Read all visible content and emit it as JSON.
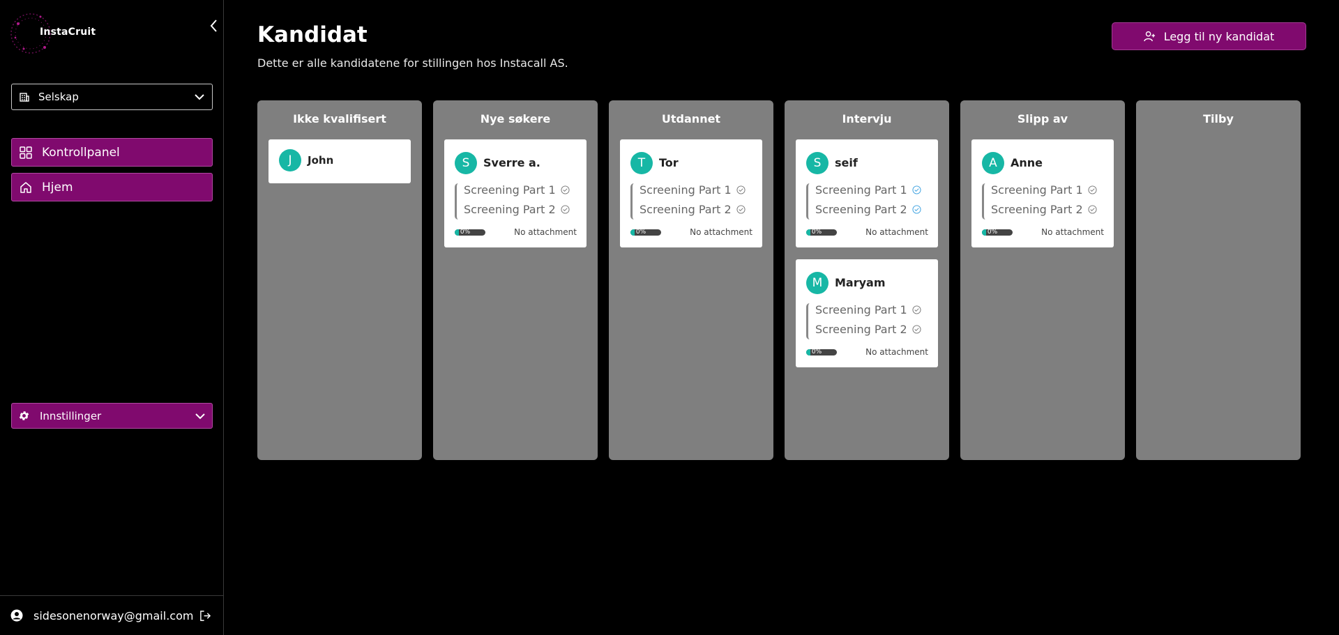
{
  "sidebar": {
    "logo_text": "InstaCruit",
    "company_select": "Selskap",
    "nav": [
      {
        "label": "Kontrollpanel",
        "icon": "grid-icon"
      },
      {
        "label": "Hjem",
        "icon": "home-icon"
      }
    ],
    "settings_label": "Innstillinger",
    "user_email": "sidesonenorway@gmail.com"
  },
  "header": {
    "title": "Kandidat",
    "subtitle": "Dette er alle kandidatene for stillingen hos Instacall AS.",
    "add_button": "Legg til ny kandidat"
  },
  "colors": {
    "accent": "#800a6e",
    "avatar": "#17b7a5",
    "column_bg": "#7f7f7f",
    "check_active": "#3aa0e0"
  },
  "columns": [
    {
      "title": "Ikke kvalifisert",
      "cards": [
        {
          "initial": "J",
          "name": "John",
          "compact": true
        }
      ]
    },
    {
      "title": "Nye søkere",
      "cards": [
        {
          "initial": "S",
          "name": "Sverre a.",
          "screen1": "Screening Part 1",
          "screen2": "Screening Part 2",
          "progress": "0%",
          "progress_value": 0,
          "attachment": "No attachment"
        }
      ]
    },
    {
      "title": "Utdannet",
      "cards": [
        {
          "initial": "T",
          "name": "Tor",
          "screen1": "Screening Part 1",
          "screen2": "Screening Part 2",
          "progress": "0%",
          "progress_value": 0,
          "attachment": "No attachment"
        }
      ]
    },
    {
      "title": "Intervju",
      "cards": [
        {
          "initial": "S",
          "name": "seif",
          "screen1": "Screening Part 1",
          "screen2": "Screening Part 2",
          "progress": "0%",
          "progress_value": 0,
          "attachment": "No attachment",
          "checks_active": true
        },
        {
          "initial": "M",
          "name": "Maryam",
          "screen1": "Screening Part 1",
          "screen2": "Screening Part 2",
          "progress": "0%",
          "progress_value": 0,
          "attachment": "No attachment"
        }
      ]
    },
    {
      "title": "Slipp av",
      "cards": [
        {
          "initial": "A",
          "name": "Anne",
          "screen1": "Screening Part 1",
          "screen2": "Screening Part 2",
          "progress": "0%",
          "progress_value": 0,
          "attachment": "No attachment"
        }
      ]
    },
    {
      "title": "Tilby",
      "cards": []
    }
  ]
}
